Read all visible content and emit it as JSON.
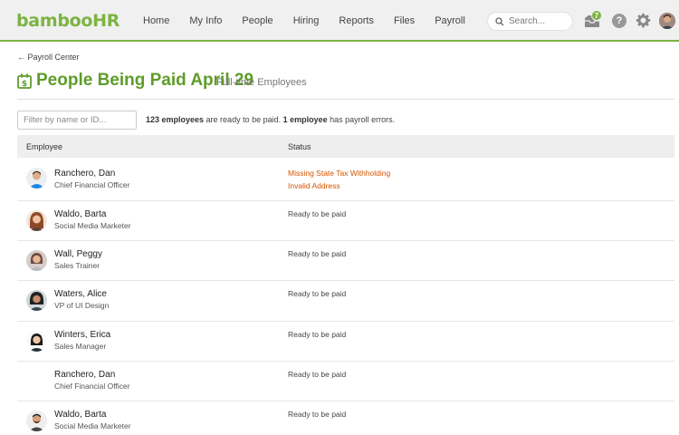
{
  "brand": {
    "logo_text": "bambooHR",
    "accent": "#7cb342",
    "title_color": "#5e9c2a",
    "error_color": "#d35400"
  },
  "nav": {
    "items": [
      "Home",
      "My Info",
      "People",
      "Hiring",
      "Reports",
      "Files",
      "Payroll"
    ]
  },
  "search": {
    "placeholder": "Search..."
  },
  "inbox": {
    "badge_count": "7"
  },
  "help": {
    "label": "?"
  },
  "breadcrumb": {
    "label": "← Payroll Center"
  },
  "header": {
    "title": "People Being Paid April 29",
    "subtitle": "Full-time Employees"
  },
  "filter": {
    "placeholder": "Filter by name or ID..."
  },
  "summary": {
    "ready_count": "123 employees",
    "ready_text": " are ready to be paid. ",
    "error_count": "1 employee",
    "error_text": " has payroll errors."
  },
  "table": {
    "columns": {
      "employee": "Employee",
      "status": "Status"
    },
    "rows": [
      {
        "name": "Ranchero, Dan",
        "title": "Chief Financial Officer",
        "statuses": [
          "Missing State Tax Withholding",
          "Invalid Address"
        ],
        "error": true,
        "avatar": "man-blue"
      },
      {
        "name": "Waldo, Barta",
        "title": "Social Media Marketer",
        "statuses": [
          "Ready to be paid"
        ],
        "error": false,
        "avatar": "woman-auburn"
      },
      {
        "name": "Wall, Peggy",
        "title": "Sales Trainer",
        "statuses": [
          "Ready to be paid"
        ],
        "error": false,
        "avatar": "woman-brown"
      },
      {
        "name": "Waters, Alice",
        "title": "VP of UI Design",
        "statuses": [
          "Ready to be paid"
        ],
        "error": false,
        "avatar": "woman-dark"
      },
      {
        "name": "Winters, Erica",
        "title": "Sales Manager",
        "statuses": [
          "Ready to be paid"
        ],
        "error": false,
        "avatar": "woman-black-hair"
      },
      {
        "name": "Ranchero, Dan",
        "title": "Chief Financial Officer",
        "statuses": [
          "Ready to be paid"
        ],
        "error": false,
        "avatar": "none"
      },
      {
        "name": "Waldo, Barta",
        "title": "Social Media Marketer",
        "statuses": [
          "Ready to be paid"
        ],
        "error": false,
        "avatar": "man-beard"
      }
    ]
  }
}
